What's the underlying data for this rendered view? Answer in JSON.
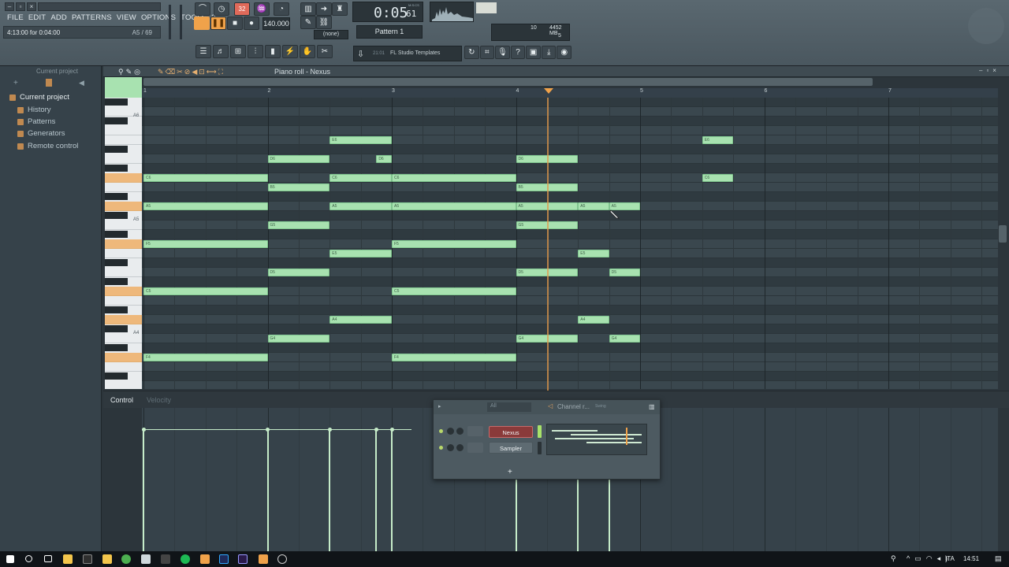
{
  "menu": [
    "FILE",
    "EDIT",
    "ADD",
    "PATTERNS",
    "VIEW",
    "OPTIONS",
    "TOOLS",
    "?"
  ],
  "hint": {
    "left": "4:13:00 for 0:04:00",
    "right": "A5 / 69"
  },
  "transport": {
    "time": "0:05",
    "time_sub": "61",
    "time_label": "M:S:CS",
    "tempo": "140.000",
    "snap": "(none)",
    "pattern": "Pattern 1",
    "mode_label": "32"
  },
  "meters": {
    "cpu": "10",
    "memory": "4452 MB",
    "voices": "5"
  },
  "templates": {
    "num": "21:01",
    "label": "FL Studio Templates"
  },
  "browser": {
    "title": "Current project",
    "root": "Current project",
    "items": [
      "History",
      "Patterns",
      "Generators",
      "Remote control"
    ]
  },
  "piano_roll": {
    "title": "Piano roll - Nexus",
    "bars": [
      "1",
      "2",
      "3",
      "4",
      "5",
      "6",
      "7"
    ],
    "key_labels": [
      "A6",
      "A5",
      "A4"
    ],
    "notes": [
      {
        "label": "E6",
        "pitch": 88,
        "start": 1.5,
        "len": 0.5
      },
      {
        "label": "E6",
        "pitch": 88,
        "start": 4.5,
        "len": 0.25
      },
      {
        "label": "D6",
        "pitch": 86,
        "start": 1.0,
        "len": 0.5
      },
      {
        "label": "D6",
        "pitch": 86,
        "start": 1.875,
        "len": 0.125
      },
      {
        "label": "D6",
        "pitch": 86,
        "start": 3.0,
        "len": 0.5
      },
      {
        "label": "C6",
        "pitch": 84,
        "start": 0.0,
        "len": 1.0
      },
      {
        "label": "C6",
        "pitch": 84,
        "start": 1.5,
        "len": 0.5
      },
      {
        "label": "C6",
        "pitch": 84,
        "start": 2.0,
        "len": 1.0
      },
      {
        "label": "C6",
        "pitch": 84,
        "start": 4.5,
        "len": 0.25
      },
      {
        "label": "B5",
        "pitch": 83,
        "start": 1.0,
        "len": 0.5
      },
      {
        "label": "B5",
        "pitch": 83,
        "start": 3.0,
        "len": 0.5
      },
      {
        "label": "A5",
        "pitch": 81,
        "start": 0.0,
        "len": 1.0
      },
      {
        "label": "A5",
        "pitch": 81,
        "start": 1.5,
        "len": 0.5
      },
      {
        "label": "A5",
        "pitch": 81,
        "start": 2.0,
        "len": 1.0
      },
      {
        "label": "A5",
        "pitch": 81,
        "start": 3.0,
        "len": 0.5
      },
      {
        "label": "A5",
        "pitch": 81,
        "start": 3.5,
        "len": 0.25
      },
      {
        "label": "A5",
        "pitch": 81,
        "start": 3.75,
        "len": 0.25
      },
      {
        "label": "G5",
        "pitch": 79,
        "start": 1.0,
        "len": 0.5
      },
      {
        "label": "G5",
        "pitch": 79,
        "start": 3.0,
        "len": 0.5
      },
      {
        "label": "F5",
        "pitch": 77,
        "start": 0.0,
        "len": 1.0
      },
      {
        "label": "F5",
        "pitch": 77,
        "start": 2.0,
        "len": 1.0
      },
      {
        "label": "E5",
        "pitch": 76,
        "start": 1.5,
        "len": 0.5
      },
      {
        "label": "E5",
        "pitch": 76,
        "start": 3.5,
        "len": 0.25
      },
      {
        "label": "D5",
        "pitch": 74,
        "start": 1.0,
        "len": 0.5
      },
      {
        "label": "D5",
        "pitch": 74,
        "start": 3.0,
        "len": 0.5
      },
      {
        "label": "D5",
        "pitch": 74,
        "start": 3.75,
        "len": 0.25
      },
      {
        "label": "C5",
        "pitch": 72,
        "start": 0.0,
        "len": 1.0
      },
      {
        "label": "C5",
        "pitch": 72,
        "start": 2.0,
        "len": 1.0
      },
      {
        "label": "A4",
        "pitch": 69,
        "start": 1.5,
        "len": 0.5
      },
      {
        "label": "A4",
        "pitch": 69,
        "start": 3.5,
        "len": 0.25
      },
      {
        "label": "G4",
        "pitch": 67,
        "start": 1.0,
        "len": 0.5
      },
      {
        "label": "G4",
        "pitch": 67,
        "start": 3.0,
        "len": 0.5
      },
      {
        "label": "G4",
        "pitch": 67,
        "start": 3.75,
        "len": 0.25
      },
      {
        "label": "F4",
        "pitch": 65,
        "start": 0.0,
        "len": 1.0
      },
      {
        "label": "F4",
        "pitch": 65,
        "start": 2.0,
        "len": 1.0
      }
    ],
    "playhead_bar": 4.25
  },
  "control": {
    "label": "Control",
    "param": "Velocity",
    "velocity_positions": [
      0.0,
      1.0,
      1.5,
      1.875,
      2.0,
      3.0,
      3.5,
      3.75
    ]
  },
  "channel_rack": {
    "title": "Channel r...",
    "filter": "All",
    "swing": "Swing",
    "channels": [
      "Nexus",
      "Sampler"
    ],
    "add": "+"
  },
  "taskbar": {
    "lang": "ITA",
    "time": "14:51"
  },
  "colors": {
    "note": "#a8e2b0",
    "playhead": "#e39a4c",
    "accent": "#f0a24a",
    "nexus": "#8a3a3a"
  }
}
